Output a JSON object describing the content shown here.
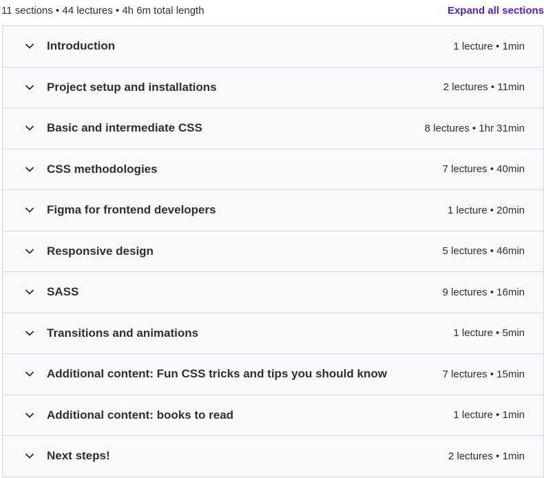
{
  "summary": {
    "text": "11 sections • 44 lectures • 4h 6m total length",
    "expand_label": "Expand all sections"
  },
  "colors": {
    "accent": "#5022c3",
    "row_bg": "#f7f9fa",
    "border": "#d1d7dc",
    "text": "#2d2f31"
  },
  "sections": [
    {
      "title": "Introduction",
      "meta": "1 lecture • 1min",
      "icon": "chevron-down-icon"
    },
    {
      "title": "Project setup and installations",
      "meta": "2 lectures • 11min",
      "icon": "chevron-down-icon"
    },
    {
      "title": "Basic and intermediate CSS",
      "meta": "8 lectures • 1hr 31min",
      "icon": "chevron-down-icon"
    },
    {
      "title": "CSS methodologies",
      "meta": "7 lectures • 40min",
      "icon": "chevron-down-icon"
    },
    {
      "title": "Figma for frontend developers",
      "meta": "1 lecture • 20min",
      "icon": "chevron-down-icon"
    },
    {
      "title": "Responsive design",
      "meta": "5 lectures • 46min",
      "icon": "chevron-down-icon"
    },
    {
      "title": "SASS",
      "meta": "9 lectures • 16min",
      "icon": "chevron-down-icon"
    },
    {
      "title": "Transitions and animations",
      "meta": "1 lecture • 5min",
      "icon": "chevron-down-icon"
    },
    {
      "title": "Additional content: Fun CSS tricks and tips you should know",
      "meta": "7 lectures • 15min",
      "icon": "chevron-down-icon"
    },
    {
      "title": "Additional content: books to read",
      "meta": "1 lecture • 1min",
      "icon": "chevron-down-icon"
    },
    {
      "title": "Next steps!",
      "meta": "2 lectures • 1min",
      "icon": "chevron-down-icon"
    }
  ]
}
